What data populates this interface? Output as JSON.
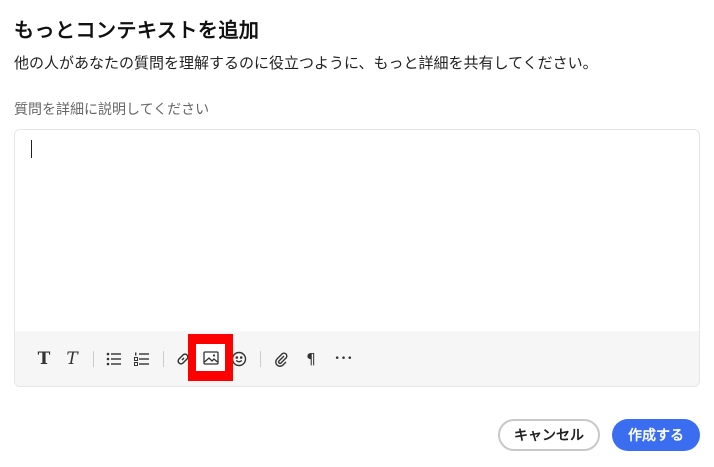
{
  "dialog": {
    "title": "もっとコンテキストを追加",
    "subtitle": "他の人があなたの質問を理解するのに役立つように、もっと詳細を共有してください。",
    "field_label": "質問を詳細に説明してください",
    "field_value": ""
  },
  "toolbar": {
    "icons": [
      "bold-icon",
      "italic-icon",
      "bullet-list-icon",
      "numbered-list-icon",
      "link-icon",
      "image-icon",
      "emoji-icon",
      "attachment-icon",
      "paragraph-icon",
      "more-icon"
    ],
    "bold_glyph": "T",
    "italic_glyph": "T",
    "paragraph_glyph": "¶",
    "more_glyph": "•••"
  },
  "buttons": {
    "cancel_label": "キャンセル",
    "create_label": "作成する"
  },
  "colors": {
    "primary": "#3b6df0",
    "highlight": "#ff0000"
  }
}
